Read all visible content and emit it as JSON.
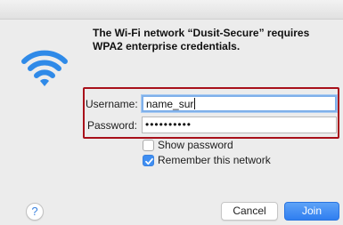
{
  "dialog": {
    "message": "The Wi-Fi network “Dusit-Secure” requires WPA2 enterprise credentials."
  },
  "credentials": {
    "username_label": "Username:",
    "username_value": "name_sur",
    "password_label": "Password:",
    "password_value": "••••••••••"
  },
  "options": {
    "show_password_label": "Show password",
    "show_password_checked": false,
    "remember_label": "Remember this network",
    "remember_checked": true
  },
  "buttons": {
    "help_label": "?",
    "cancel_label": "Cancel",
    "join_label": "Join"
  },
  "colors": {
    "accent": "#3f8ef2",
    "highlight_box": "#a8101a",
    "wifi_icon": "#2f8ae8"
  },
  "icons": {
    "wifi": "wifi-icon",
    "help": "help-icon",
    "checkmark": "checkmark-icon"
  }
}
